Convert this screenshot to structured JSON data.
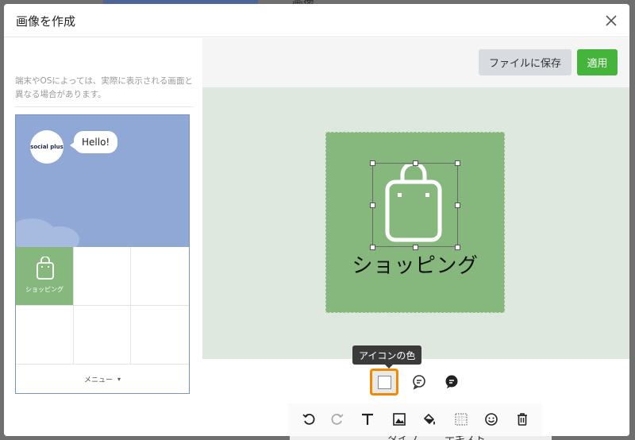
{
  "modal": {
    "title": "画像を作成",
    "close_icon": "close-icon"
  },
  "preview": {
    "hint": "端末やOSによっては、実際に表示される画面と異なる場合があります。",
    "avatar_text": "social plus",
    "bubble_text": "Hello!",
    "menu_cells": [
      "ショッピング",
      "",
      "",
      "",
      "",
      ""
    ],
    "menu_bar_label": "メニュー",
    "menu_bar_caret": "▾"
  },
  "actions": {
    "save_file_label": "ファイルに保存",
    "apply_label": "適用"
  },
  "canvas": {
    "caption": "ショッピング",
    "icon": "shopping-bag-icon",
    "bg_color": "#86b87e",
    "icon_color": "#ffffff"
  },
  "tools": {
    "tooltip": "アイコンの色",
    "row1": [
      "icon-color",
      "speech-bubble-outline-icon",
      "speech-bubble-filled-icon"
    ],
    "row2": [
      "undo-icon",
      "redo-icon",
      "text-icon",
      "image-icon",
      "fill-icon",
      "transparency-icon",
      "emoji-icon",
      "trash-icon"
    ]
  },
  "background": {
    "top_text": "画像",
    "bottom_texts": [
      "タイプ",
      "テキスト"
    ]
  }
}
